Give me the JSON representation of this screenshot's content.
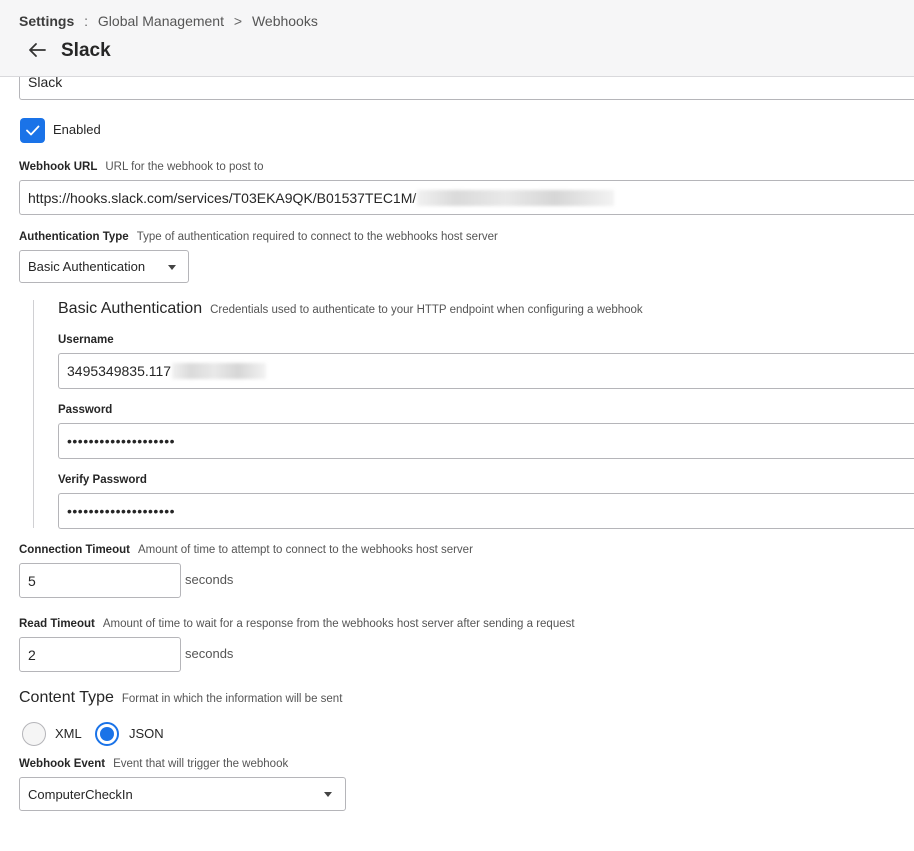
{
  "header": {
    "breadcrumb": {
      "root": "Settings",
      "separator": ":",
      "section": "Global Management",
      "chevron": ">",
      "current": "Webhooks"
    },
    "back_icon": "arrow-left-icon",
    "title": "Slack"
  },
  "form": {
    "name": {
      "value": "Slack"
    },
    "enabled": {
      "label": "Enabled",
      "checked": true
    },
    "webhook_url": {
      "label": "Webhook URL",
      "description": "URL for the webhook to post to",
      "value": "https://hooks.slack.com/services/T03EKA9QK/B01537TEC1M/"
    },
    "auth_type": {
      "label": "Authentication Type",
      "description": "Type of authentication required to connect to the webhooks host server",
      "selected": "Basic Authentication"
    },
    "basic_auth": {
      "title": "Basic Authentication",
      "description": "Credentials used to authenticate to your HTTP endpoint when configuring a webhook",
      "username": {
        "label": "Username",
        "value": "3495349835.117"
      },
      "password": {
        "label": "Password",
        "value": "••••••••••••••••••••"
      },
      "verify_password": {
        "label": "Verify Password",
        "value": "••••••••••••••••••••"
      }
    },
    "connection_timeout": {
      "label": "Connection Timeout",
      "description": "Amount of time to attempt to connect to the webhooks host server",
      "value": "5",
      "unit": "seconds"
    },
    "read_timeout": {
      "label": "Read Timeout",
      "description": "Amount of time to wait for a response from the webhooks host server after sending a request",
      "value": "2",
      "unit": "seconds"
    },
    "content_type": {
      "title": "Content Type",
      "description": "Format in which the information will be sent",
      "options": [
        {
          "label": "XML",
          "checked": false
        },
        {
          "label": "JSON",
          "checked": true
        }
      ]
    },
    "webhook_event": {
      "label": "Webhook Event",
      "description": "Event that will trigger the webhook",
      "selected": "ComputerCheckIn"
    }
  },
  "colors": {
    "accent": "#1a73e8",
    "header_bg": "#f6f6f7",
    "border": "#b5b5b9"
  }
}
